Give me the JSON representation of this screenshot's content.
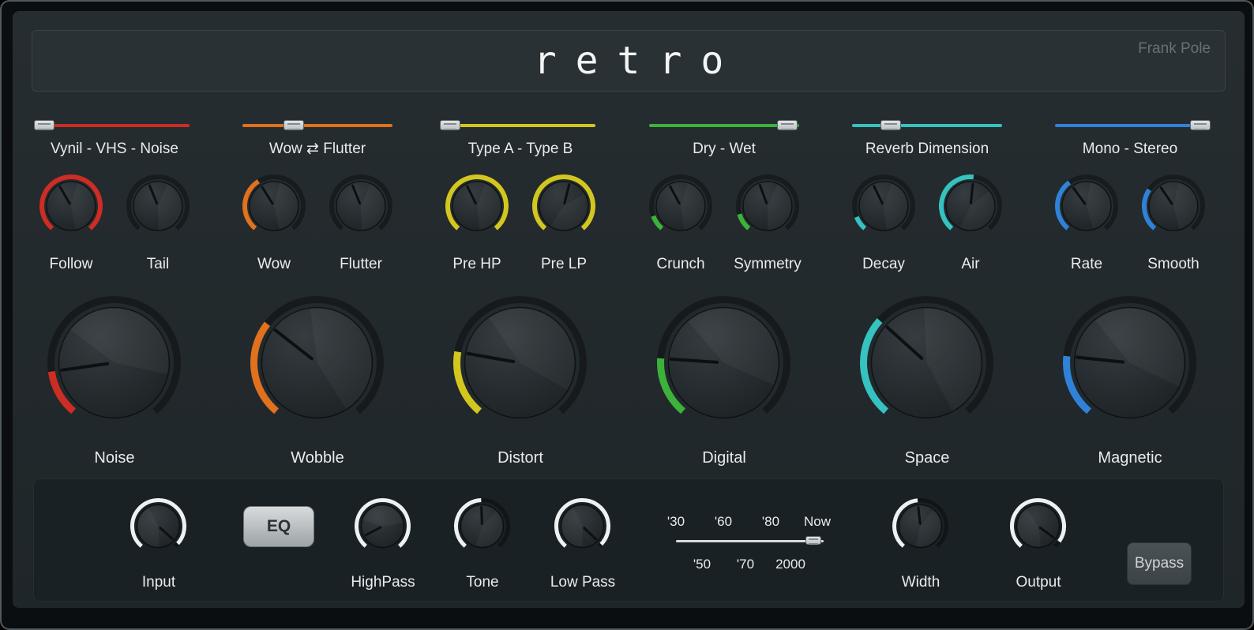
{
  "header": {
    "title": "retro",
    "brand": "Frank Pole"
  },
  "sections": [
    {
      "slider": {
        "label": "Vynil - VHS - Noise",
        "position": 3,
        "color": "#cd2d24"
      },
      "knob1": {
        "label": "Follow",
        "color": "#cd2d24",
        "arc_start": -140,
        "arc_end": 140,
        "pointer": -30
      },
      "knob2": {
        "label": "Tail",
        "color": "#cd2d24",
        "arc_start": -140,
        "arc_end": -140,
        "pointer": -22
      },
      "big": {
        "label": "Noise",
        "color": "#cd2d24",
        "arc_start": -140,
        "arc_end": -98,
        "pointer": -98
      }
    },
    {
      "slider": {
        "label": "Wow ⇄ Flutter",
        "position": 34,
        "color": "#e0711e"
      },
      "knob1": {
        "label": "Wow",
        "color": "#e0711e",
        "arc_start": -140,
        "arc_end": -32,
        "pointer": -32
      },
      "knob2": {
        "label": "Flutter",
        "color": "#e0711e",
        "arc_start": -140,
        "arc_end": -140,
        "pointer": -22
      },
      "big": {
        "label": "Wobble",
        "color": "#e0711e",
        "arc_start": -140,
        "arc_end": -52,
        "pointer": -52
      }
    },
    {
      "slider": {
        "label": "Type A - Type B",
        "position": 3,
        "color": "#d3c71f"
      },
      "knob1": {
        "label": "Pre HP",
        "color": "#d3c71f",
        "arc_start": -140,
        "arc_end": 140,
        "pointer": -26
      },
      "knob2": {
        "label": "Pre LP",
        "color": "#d3c71f",
        "arc_start": -140,
        "arc_end": 140,
        "pointer": 14
      },
      "big": {
        "label": "Distort",
        "color": "#d3c71f",
        "arc_start": -140,
        "arc_end": -80,
        "pointer": -80
      }
    },
    {
      "slider": {
        "label": "Dry - Wet",
        "position": 92,
        "color": "#3cb23a"
      },
      "knob1": {
        "label": "Crunch",
        "color": "#3cb23a",
        "arc_start": -140,
        "arc_end": -110,
        "pointer": -28
      },
      "knob2": {
        "label": "Symmetry",
        "color": "#3cb23a",
        "arc_start": -140,
        "arc_end": -106,
        "pointer": -20
      },
      "big": {
        "label": "Digital",
        "color": "#3cb23a",
        "arc_start": -140,
        "arc_end": -86,
        "pointer": -86
      }
    },
    {
      "slider": {
        "label": "Reverb Dimension",
        "position": 26,
        "color": "#35c2c0"
      },
      "knob1": {
        "label": "Decay",
        "color": "#35c2c0",
        "arc_start": -140,
        "arc_end": -112,
        "pointer": -26
      },
      "knob2": {
        "label": "Air",
        "color": "#35c2c0",
        "arc_start": -140,
        "arc_end": 6,
        "pointer": 6
      },
      "big": {
        "label": "Space",
        "color": "#35c2c0",
        "arc_start": -140,
        "arc_end": -48,
        "pointer": -48
      }
    },
    {
      "slider": {
        "label": "Mono - Stereo",
        "position": 97,
        "color": "#2f82d8"
      },
      "knob1": {
        "label": "Rate",
        "color": "#2f82d8",
        "arc_start": -140,
        "arc_end": -36,
        "pointer": -36
      },
      "knob2": {
        "label": "Smooth",
        "color": "#2f82d8",
        "arc_start": -140,
        "arc_end": -56,
        "pointer": -34
      },
      "big": {
        "label": "Magnetic",
        "color": "#2f82d8",
        "arc_start": -140,
        "arc_end": -84,
        "pointer": -84
      }
    }
  ],
  "bottom": {
    "eq_button": "EQ",
    "bypass_button": "Bypass",
    "input": {
      "label": "Input",
      "color": "#eef1f1",
      "arc_start": -140,
      "arc_end": 132,
      "pointer": 132
    },
    "highpass": {
      "label": "HighPass",
      "color": "#eef1f1",
      "arc_start": -140,
      "arc_end": 140,
      "pointer": -118
    },
    "tone": {
      "label": "Tone",
      "color": "#eef1f1",
      "arc_start": -140,
      "arc_end": -2,
      "pointer": -2
    },
    "lowpass": {
      "label": "Low Pass",
      "color": "#eef1f1",
      "arc_start": -140,
      "arc_end": 134,
      "pointer": 134
    },
    "width": {
      "label": "Width",
      "color": "#eef1f1",
      "arc_start": -140,
      "arc_end": -6,
      "pointer": -6
    },
    "output": {
      "label": "Output",
      "color": "#eef1f1",
      "arc_start": -140,
      "arc_end": 126,
      "pointer": 126
    },
    "era_slider": {
      "top_labels": [
        "'30",
        "'60",
        "'80",
        "Now"
      ],
      "bottom_labels": [
        "'50",
        "'70",
        "2000"
      ],
      "position": 93,
      "color": "#d9dcdc"
    }
  }
}
